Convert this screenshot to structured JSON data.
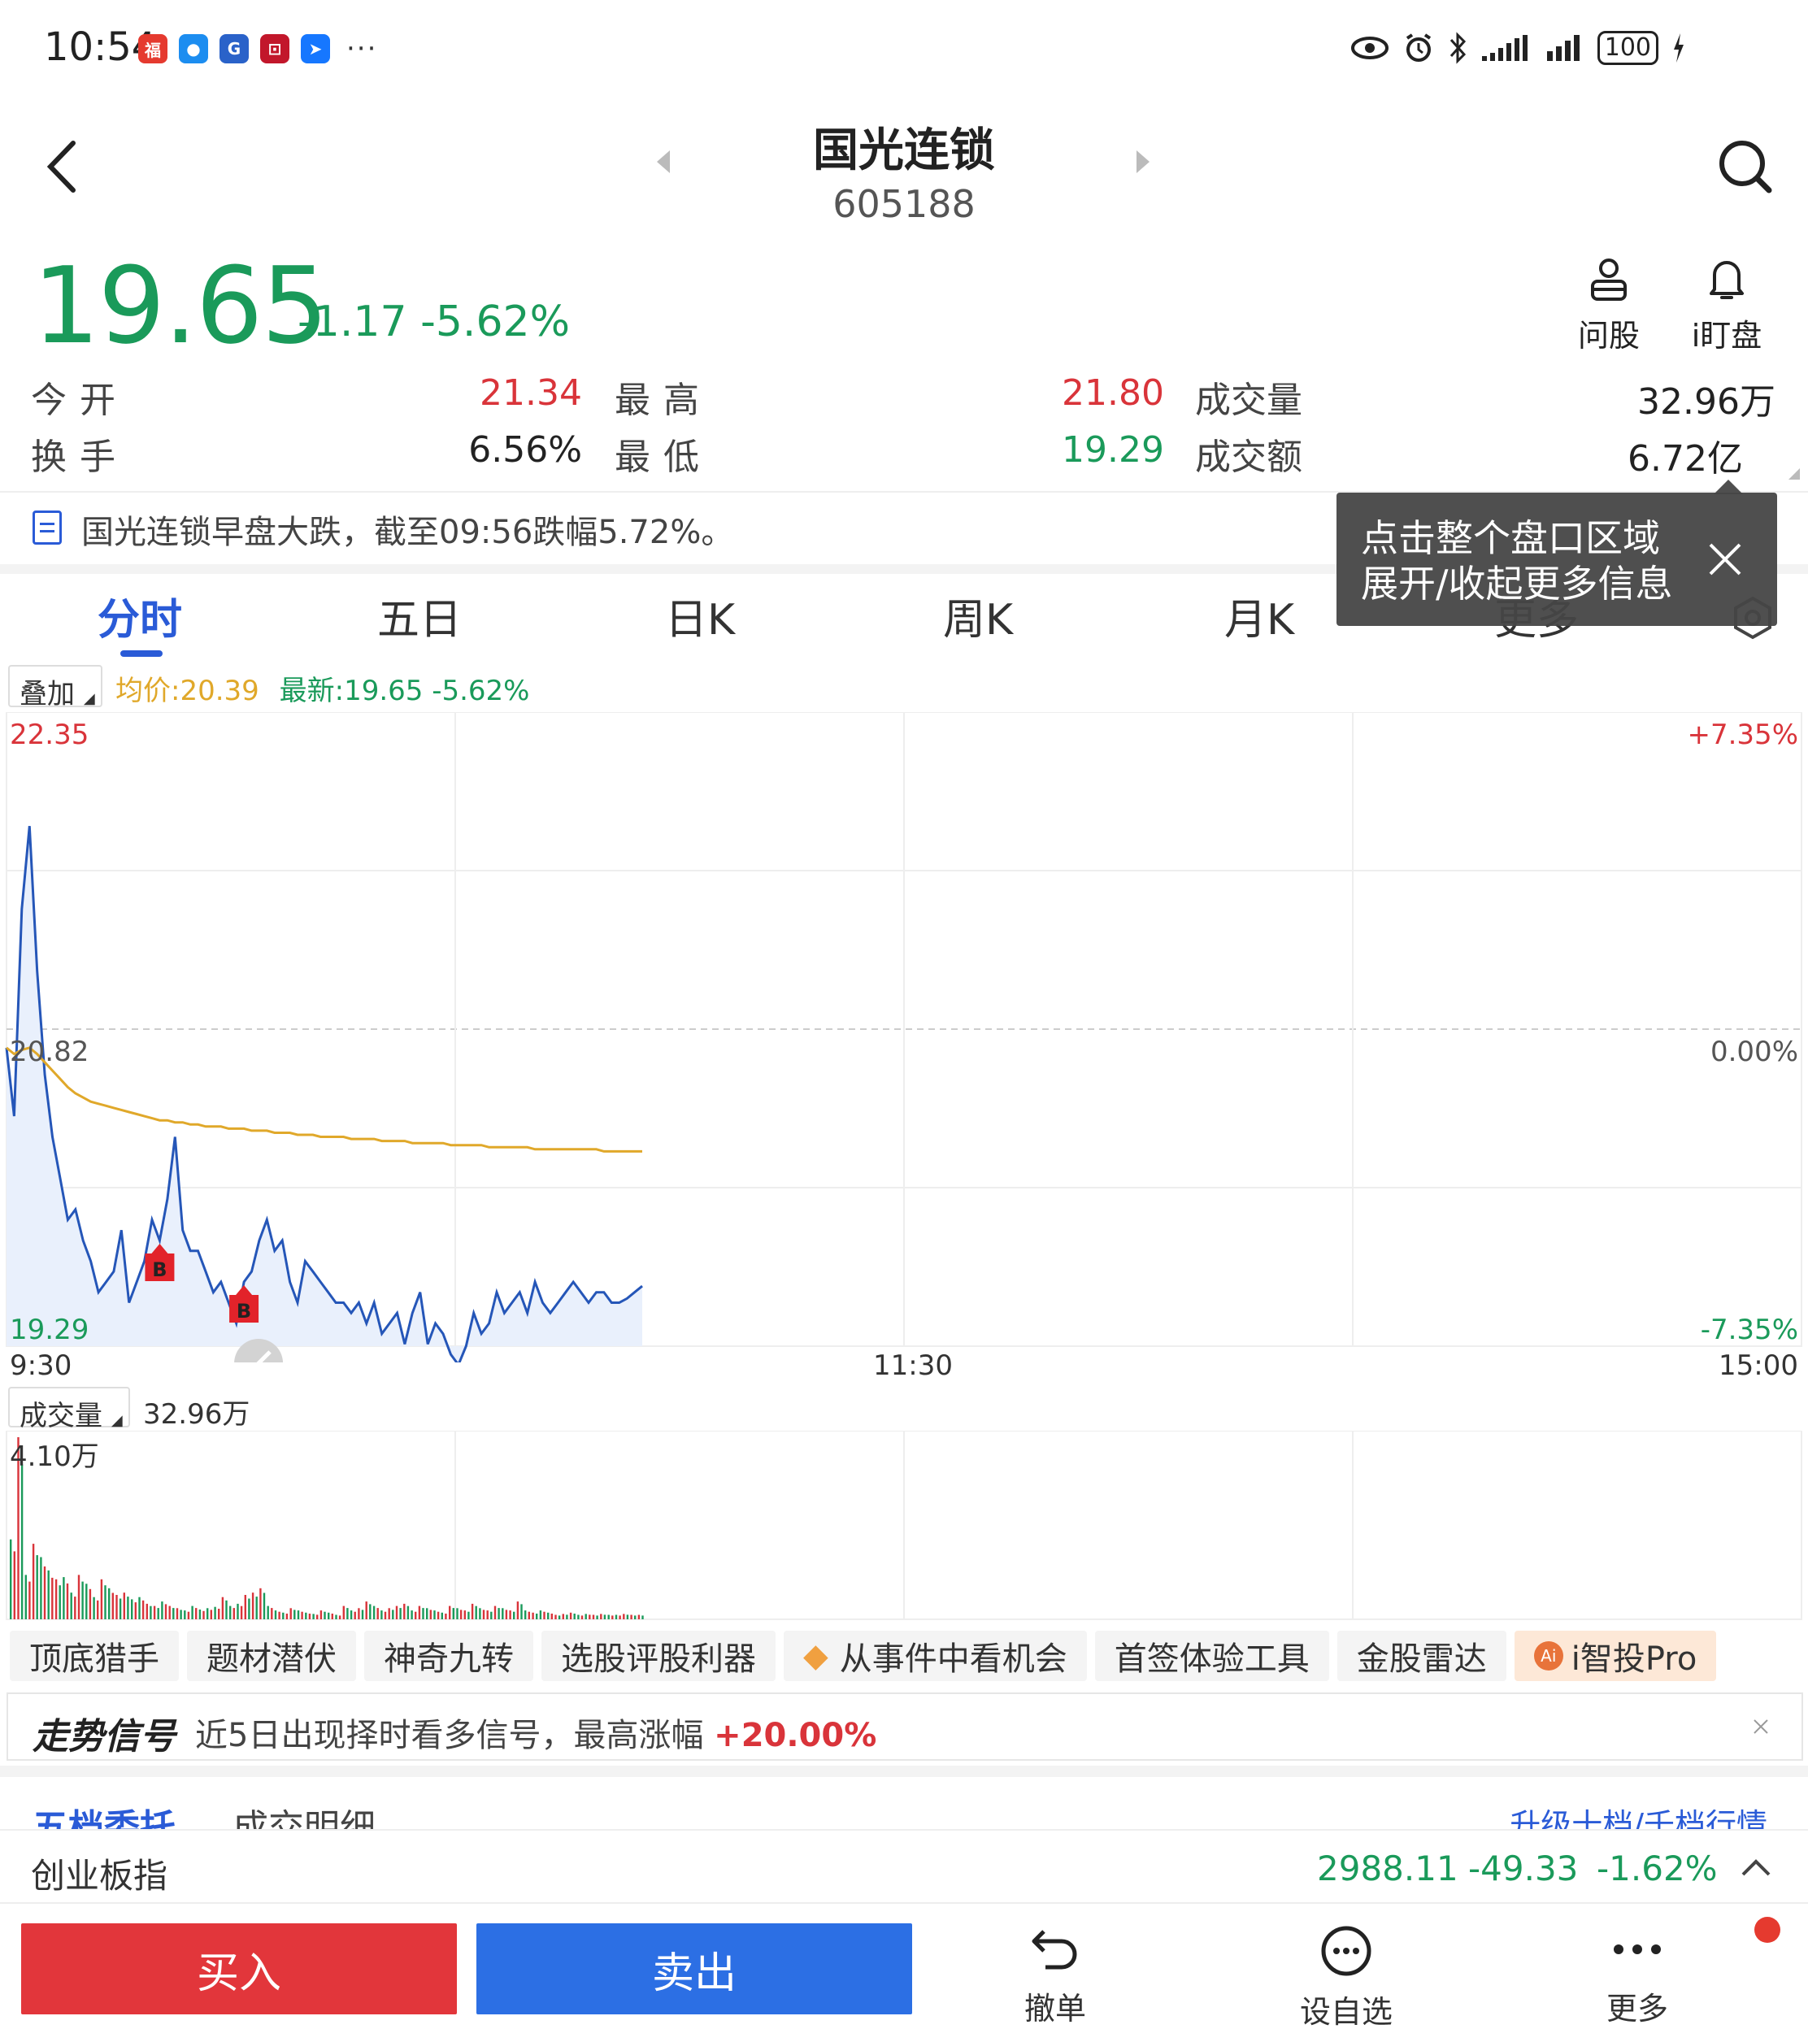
{
  "status": {
    "time": "10:54",
    "battery": "100"
  },
  "header": {
    "title": "国光连锁",
    "code": "605188"
  },
  "quote": {
    "price": "19.65",
    "change": "-1.17",
    "change_pct": "-5.62%",
    "open_label": "今开",
    "open": "21.34",
    "high_label": "最高",
    "high": "21.80",
    "volume_label": "成交量",
    "volume": "32.96万",
    "turnover_label": "换手",
    "turnover": "6.56%",
    "low_label": "最低",
    "low": "19.29",
    "amount_label": "成交额",
    "amount": "6.72亿"
  },
  "tools": {
    "ask": "问股",
    "ding": "i盯盘"
  },
  "news": {
    "text": "国光连锁早盘大跌，截至09:56跌幅5.72%。"
  },
  "tooltip": {
    "line1": "点击整个盘口区域",
    "line2": "展开/收起更多信息"
  },
  "tabs": [
    {
      "label": "分时"
    },
    {
      "label": "五日"
    },
    {
      "label": "日K"
    },
    {
      "label": "周K"
    },
    {
      "label": "月K"
    },
    {
      "label": "更多"
    }
  ],
  "legend": {
    "overlay": "叠加",
    "avg": "均价:20.39",
    "latest": "最新:19.65 -5.62%"
  },
  "chart_data": {
    "type": "line",
    "y_high": "22.35",
    "y_mid": "20.82",
    "y_low": "19.29",
    "pct_high": "+7.35%",
    "pct_mid": "0.00%",
    "pct_low": "-7.35%",
    "ylim": [
      19.29,
      22.35
    ],
    "x_start": "9:30",
    "x_mid": "11:30",
    "x_end": "15:00",
    "total_minutes": 240,
    "price": [
      20.73,
      20.4,
      21.4,
      21.8,
      21.1,
      20.6,
      20.3,
      20.1,
      19.9,
      19.95,
      19.8,
      19.7,
      19.55,
      19.6,
      19.65,
      19.85,
      19.5,
      19.6,
      19.7,
      19.9,
      19.8,
      20.0,
      20.3,
      19.85,
      19.75,
      19.75,
      19.65,
      19.55,
      19.6,
      19.5,
      19.4,
      19.6,
      19.65,
      19.8,
      19.9,
      19.75,
      19.8,
      19.6,
      19.5,
      19.7,
      19.65,
      19.6,
      19.55,
      19.5,
      19.5,
      19.45,
      19.5,
      19.4,
      19.5,
      19.35,
      19.4,
      19.45,
      19.3,
      19.45,
      19.55,
      19.3,
      19.4,
      19.35,
      19.25,
      19.2,
      19.29,
      19.45,
      19.35,
      19.4,
      19.55,
      19.45,
      19.5,
      19.55,
      19.45,
      19.6,
      19.5,
      19.45,
      19.5,
      19.55,
      19.6,
      19.55,
      19.5,
      19.55,
      19.55,
      19.5,
      19.5,
      19.52,
      19.55,
      19.58
    ],
    "avg": [
      20.73,
      20.7,
      20.72,
      20.73,
      20.7,
      20.66,
      20.62,
      20.58,
      20.54,
      20.51,
      20.49,
      20.47,
      20.46,
      20.45,
      20.44,
      20.43,
      20.42,
      20.41,
      20.4,
      20.39,
      20.38,
      20.38,
      20.37,
      20.37,
      20.36,
      20.36,
      20.35,
      20.35,
      20.35,
      20.34,
      20.34,
      20.34,
      20.33,
      20.33,
      20.33,
      20.32,
      20.32,
      20.32,
      20.31,
      20.31,
      20.31,
      20.3,
      20.3,
      20.3,
      20.3,
      20.29,
      20.29,
      20.29,
      20.29,
      20.28,
      20.28,
      20.28,
      20.28,
      20.27,
      20.27,
      20.27,
      20.27,
      20.27,
      20.26,
      20.26,
      20.26,
      20.26,
      20.26,
      20.25,
      20.25,
      20.25,
      20.25,
      20.25,
      20.25,
      20.24,
      20.24,
      20.24,
      20.24,
      20.24,
      20.24,
      20.24,
      20.24,
      20.24,
      20.23,
      20.23,
      20.23,
      20.23,
      20.23,
      20.23
    ],
    "buy_markers": [
      {
        "index": 20,
        "label": "B"
      },
      {
        "index": 31,
        "label": "B"
      }
    ]
  },
  "volume_chart": {
    "label": "成交量",
    "total": "32.96万",
    "max_label": "4.10万",
    "max": 4.1,
    "bars": [
      1.8,
      4.1,
      1.0,
      1.7,
      1.4,
      1.1,
      0.9,
      0.95,
      0.6,
      1.0,
      0.8,
      0.5,
      0.9,
      0.7,
      0.55,
      0.6,
      0.45,
      0.5,
      0.35,
      0.3,
      0.4,
      0.3,
      0.25,
      0.2,
      0.3,
      0.22,
      0.25,
      0.28,
      0.5,
      0.3,
      0.35,
      0.55,
      0.6,
      0.7,
      0.3,
      0.2,
      0.15,
      0.25,
      0.2,
      0.15,
      0.12,
      0.2,
      0.15,
      0.1,
      0.3,
      0.2,
      0.25,
      0.4,
      0.3,
      0.2,
      0.25,
      0.3,
      0.35,
      0.2,
      0.3,
      0.25,
      0.2,
      0.15,
      0.3,
      0.25,
      0.2,
      0.35,
      0.25,
      0.2,
      0.3,
      0.25,
      0.2,
      0.4,
      0.2,
      0.15,
      0.2,
      0.15,
      0.1,
      0.12,
      0.15,
      0.1,
      0.12,
      0.1,
      0.12,
      0.1,
      0.1,
      0.12,
      0.1,
      0.1
    ],
    "up_flags": [
      0,
      1,
      0,
      1,
      0,
      0,
      1,
      0,
      0,
      1,
      0,
      0,
      1,
      0,
      1,
      1,
      0,
      0,
      1,
      1,
      0,
      1,
      1,
      0,
      0,
      0,
      0,
      0,
      1,
      0,
      0,
      1,
      1,
      1,
      0,
      0,
      0,
      1,
      0,
      0,
      0,
      1,
      0,
      0,
      1,
      0,
      1,
      1,
      0,
      0,
      1,
      1,
      1,
      0,
      1,
      0,
      0,
      0,
      1,
      0,
      1,
      1,
      0,
      1,
      1,
      0,
      1,
      1,
      0,
      1,
      0,
      0,
      1,
      1,
      1,
      0,
      0,
      1,
      1,
      0,
      0,
      1,
      1,
      1
    ]
  },
  "chips": [
    "顶底猎手",
    "题材潜伏",
    "神奇九转",
    "选股评股利器",
    "从事件中看机会",
    "首签体验工具",
    "金股雷达",
    "i智投Pro"
  ],
  "signal": {
    "title": "走势信号",
    "text": "近5日出现择时看多信号，最高涨幅",
    "value": "+20.00%"
  },
  "depth": {
    "tab1": "五档委托",
    "tab2": "成交明细",
    "upgrade": "升级十档/千档行情"
  },
  "index_bar": {
    "name": "创业板指",
    "value": "2988.11",
    "change": "-49.33",
    "change_pct": "-1.62%"
  },
  "bottom": {
    "buy": "买入",
    "sell": "卖出",
    "cancel": "撤单",
    "watch": "设自选",
    "more": "更多"
  },
  "colors": {
    "up": "#d9343a",
    "down": "#1a9a5a",
    "price_line": "#2556b8",
    "avg_line": "#e0a82a",
    "accent": "#2a5bd7"
  }
}
